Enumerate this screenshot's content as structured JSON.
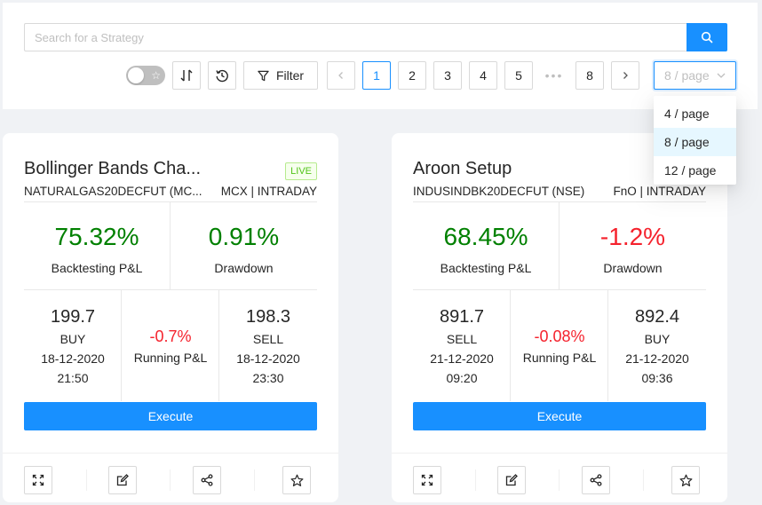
{
  "search": {
    "placeholder": "Search for a Strategy"
  },
  "toolbar": {
    "filter_label": "Filter"
  },
  "pagination": {
    "pages": [
      "1",
      "2",
      "3",
      "4",
      "5",
      "8"
    ],
    "ellipsis": "•••",
    "current": "1",
    "page_size_placeholder": "8 / page",
    "page_size_options": [
      "4 / page",
      "8 / page",
      "12 / page"
    ],
    "page_size_selected": "8 / page"
  },
  "cards": [
    {
      "title": "Bollinger Bands Cha...",
      "live_badge": "LIVE",
      "symbol": "NATURALGAS20DECFUT (MC...",
      "segment": "MCX | INTRADAY",
      "backtesting_value": "75.32%",
      "backtesting_label": "Backtesting P&L",
      "drawdown_value": "0.91%",
      "drawdown_label": "Drawdown",
      "entry": {
        "price": "199.7",
        "side": "BUY",
        "date": "18-12-2020",
        "time": "21:50"
      },
      "running_value": "-0.7%",
      "running_label": "Running P&L",
      "exit": {
        "price": "198.3",
        "side": "SELL",
        "date": "18-12-2020",
        "time": "23:30"
      },
      "execute_label": "Execute",
      "drawdown_color": "#008000"
    },
    {
      "title": "Aroon Setup",
      "live_badge": "",
      "symbol": "INDUSINDBK20DECFUT (NSE)",
      "segment": "FnO | INTRADAY",
      "backtesting_value": "68.45%",
      "backtesting_label": "Backtesting P&L",
      "drawdown_value": "-1.2%",
      "drawdown_label": "Drawdown",
      "entry": {
        "price": "891.7",
        "side": "SELL",
        "date": "21-12-2020",
        "time": "09:20"
      },
      "running_value": "-0.08%",
      "running_label": "Running P&L",
      "exit": {
        "price": "892.4",
        "side": "BUY",
        "date": "21-12-2020",
        "time": "09:36"
      },
      "execute_label": "Execute",
      "drawdown_color": "#f5222d"
    }
  ],
  "colors": {
    "primary": "#1890ff",
    "profit": "#008000",
    "loss": "#f5222d",
    "live": "#52c41a"
  },
  "icons": [
    "search-icon",
    "star-icon",
    "sort-icon",
    "history-icon",
    "filter-icon",
    "chevron-left-icon",
    "chevron-right-icon",
    "chevron-down-icon",
    "expand-icon",
    "edit-icon",
    "share-icon",
    "star-outline-icon"
  ]
}
